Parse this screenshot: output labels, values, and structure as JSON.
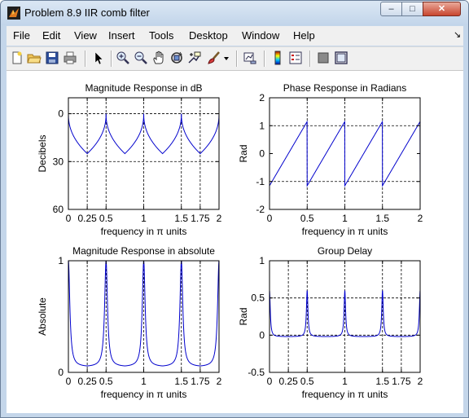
{
  "window": {
    "title": "Problem 8.9 IIR comb filter"
  },
  "titlebar_buttons": {
    "minimize": "–",
    "maximize": "□",
    "close": "✕"
  },
  "menu": [
    "File",
    "Edit",
    "View",
    "Insert",
    "Tools",
    "Desktop",
    "Window",
    "Help"
  ],
  "dock_glyph": "↘",
  "toolbar": [
    "new-figure-icon",
    "open-file-icon",
    "save-icon",
    "print-icon",
    "pointer-icon",
    "zoom-in-icon",
    "zoom-out-icon",
    "pan-hand-icon",
    "rotate-3d-icon",
    "data-cursor-icon",
    "brush-icon",
    "brush-dropdown-icon",
    "link-plot-icon",
    "colorbar-icon",
    "legend-icon",
    "hide-plot-tools-icon",
    "show-plot-tools-icon"
  ],
  "colors": {
    "line": "#0000cc",
    "grid": "#000000",
    "axes_bg": "#ffffff"
  },
  "chart_data": [
    {
      "type": "line",
      "title": "Magnitude Response in dB",
      "xlabel": "frequency in π units",
      "ylabel": "Decibels",
      "xlim": [
        0,
        2
      ],
      "ylim": [
        60,
        -10
      ],
      "y_reversed": true,
      "xticks": [
        0,
        0.25,
        0.5,
        1,
        1.5,
        1.75,
        2
      ],
      "xtick_labels": [
        "0",
        "0.25",
        "0.5",
        "1",
        "1.5",
        "1.75",
        "2"
      ],
      "yticks": [
        0,
        30,
        60
      ],
      "ytick_labels": [
        "0",
        "30",
        "60"
      ],
      "grid": {
        "x": [
          0.25,
          0.5,
          1,
          1.5,
          1.75
        ],
        "y": [
          0,
          30
        ]
      },
      "model": {
        "kind": "comb_db",
        "peaks_at": [
          0,
          0.5,
          1,
          1.5,
          2
        ],
        "peak_value": 0,
        "trough_value": 25
      }
    },
    {
      "type": "line",
      "title": "Phase Response in Radians",
      "xlabel": "frequency in π units",
      "ylabel": "Rad",
      "xlim": [
        0,
        2
      ],
      "ylim": [
        -2,
        2
      ],
      "xticks": [
        0,
        0.5,
        1,
        1.5,
        2
      ],
      "xtick_labels": [
        "0",
        "0.5",
        "1",
        "1.5",
        "2"
      ],
      "yticks": [
        -2,
        -1,
        0,
        1,
        2
      ],
      "ytick_labels": [
        "-2",
        "-1",
        "0",
        "1",
        "2"
      ],
      "grid": {
        "x": [
          0.5,
          1,
          1.5
        ],
        "y": [
          -1,
          1
        ]
      },
      "model": {
        "kind": "sawtooth",
        "period": 0.5,
        "min": -1.15,
        "max": 1.15
      }
    },
    {
      "type": "line",
      "title": "Magnitude Response in absolute",
      "xlabel": "frequency in π units",
      "ylabel": "Absolute",
      "xlim": [
        0,
        2
      ],
      "ylim": [
        0,
        1
      ],
      "xticks": [
        0,
        0.25,
        0.5,
        1,
        1.5,
        1.75,
        2
      ],
      "xtick_labels": [
        "0",
        "0.25",
        "0.5",
        "1",
        "1.5",
        "1.75",
        "2"
      ],
      "yticks": [
        0,
        1
      ],
      "ytick_labels": [
        "0",
        "1"
      ],
      "grid": {
        "x": [
          0.25,
          0.5,
          1,
          1.5,
          1.75
        ],
        "y": []
      },
      "model": {
        "kind": "comb_abs",
        "peaks_at": [
          0,
          0.5,
          1,
          1.5,
          2
        ],
        "peak_value": 1,
        "trough_value": 0.05
      }
    },
    {
      "type": "line",
      "title": "Group Delay",
      "xlabel": "frequency in π units",
      "ylabel": "Rad",
      "xlim": [
        0,
        2
      ],
      "ylim": [
        -0.5,
        1
      ],
      "xticks": [
        0,
        0.25,
        0.5,
        1,
        1.5,
        1.75,
        2
      ],
      "xtick_labels": [
        "0",
        "0.25",
        "0.5",
        "1",
        "1.5",
        "1.75",
        "2"
      ],
      "yticks": [
        -0.5,
        0,
        0.5,
        1
      ],
      "ytick_labels": [
        "-0.5",
        "0",
        "0.5",
        "1"
      ],
      "grid": {
        "x": [
          0.25,
          0.5,
          1,
          1.5,
          1.75
        ],
        "y": [
          0,
          0.5
        ]
      },
      "model": {
        "kind": "spikes",
        "peaks_at": [
          0,
          0.5,
          1,
          1.5,
          2
        ],
        "peak_value": 0.6,
        "base_value": -0.02
      }
    }
  ]
}
